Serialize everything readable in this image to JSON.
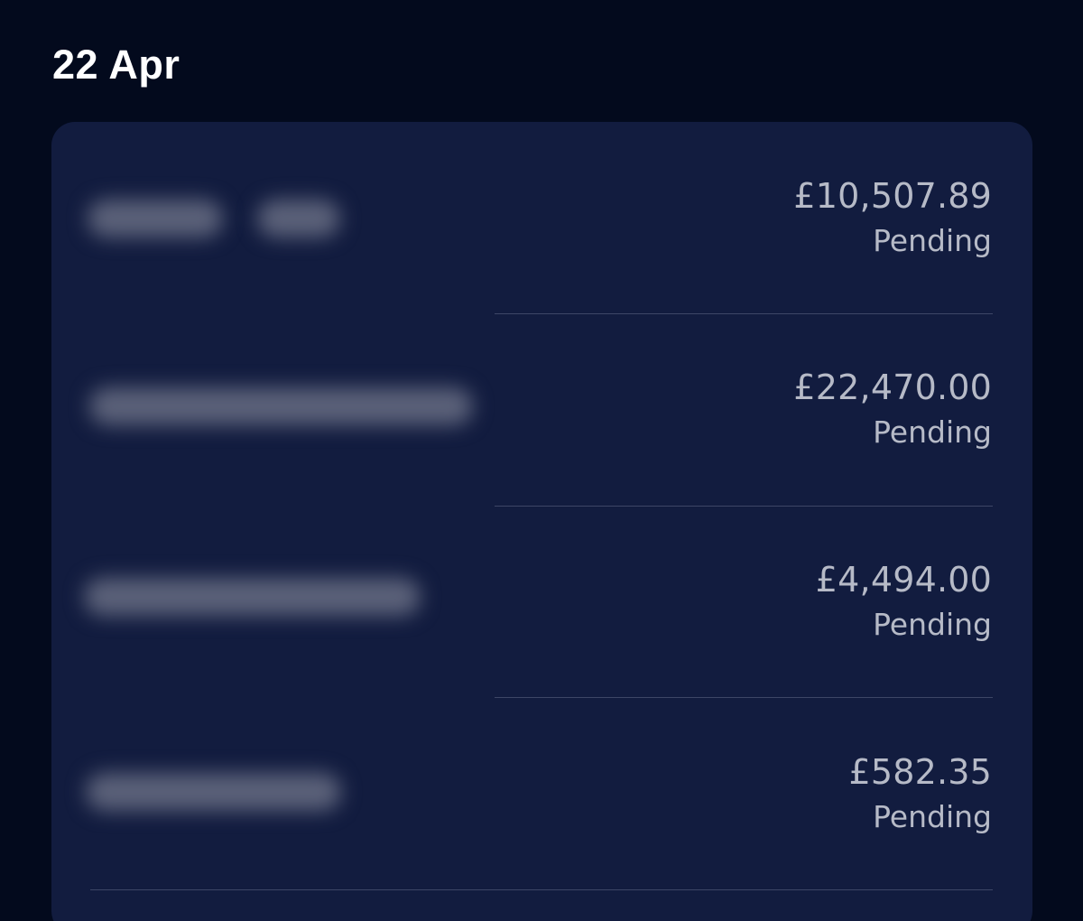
{
  "header": {
    "date": "22 Apr"
  },
  "transactions": [
    {
      "amount": "£10,507.89",
      "status": "Pending"
    },
    {
      "amount": "£22,470.00",
      "status": "Pending"
    },
    {
      "amount": "£4,494.00",
      "status": "Pending"
    },
    {
      "amount": "£582.35",
      "status": "Pending"
    }
  ],
  "colors": {
    "background": "#030a1d",
    "card": "#121c3f",
    "text_primary": "#ffffff",
    "text_secondary": "#b6bac7",
    "divider": "#3d4666"
  }
}
